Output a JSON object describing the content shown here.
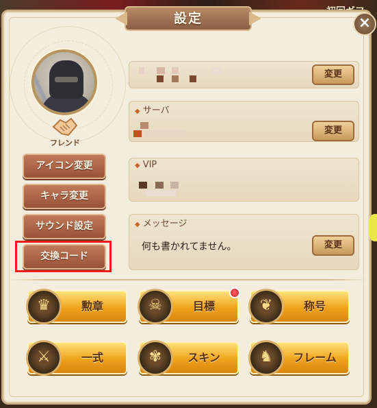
{
  "background": {
    "top_right_text": "初回ギフ"
  },
  "dialog": {
    "title": "設定",
    "close_label": "×"
  },
  "profile": {
    "friend_label": "フレンド"
  },
  "side_buttons": [
    {
      "label": "アイコン変更"
    },
    {
      "label": "キャラ変更"
    },
    {
      "label": "サウンド設定"
    },
    {
      "label": "交換コード"
    }
  ],
  "fields": {
    "name": {
      "change_label": "変更"
    },
    "server": {
      "label": "サーバ",
      "change_label": "変更"
    },
    "vip": {
      "label": "VIP"
    },
    "message": {
      "label": "メッセージ",
      "value": "何も書かれてません。",
      "change_label": "変更"
    }
  },
  "menu_buttons": [
    {
      "label": "勲章",
      "icon": "medal-icon",
      "badge": false
    },
    {
      "label": "目標",
      "icon": "target-icon",
      "badge": true
    },
    {
      "label": "称号",
      "icon": "title-icon",
      "badge": false
    },
    {
      "label": "一式",
      "icon": "set-icon",
      "badge": false
    },
    {
      "label": "スキン",
      "icon": "skin-icon",
      "badge": false
    },
    {
      "label": "フレーム",
      "icon": "frame-icon",
      "badge": false
    }
  ],
  "colors": {
    "highlight": "#ee1c1c",
    "accent_gold": "#f0a21c",
    "button_brown": "#9a5238"
  }
}
